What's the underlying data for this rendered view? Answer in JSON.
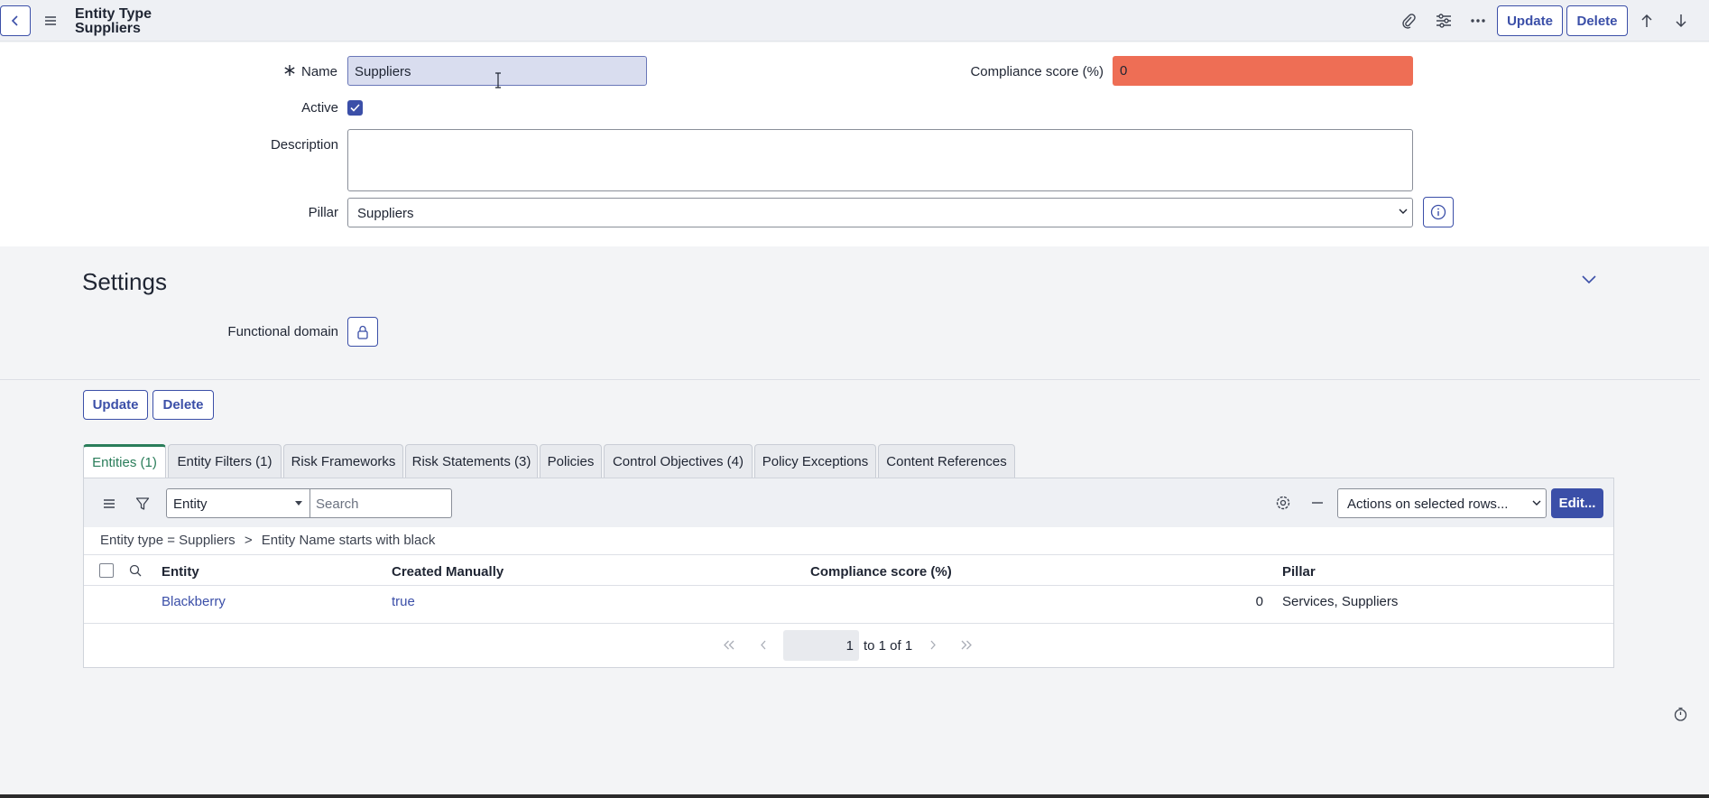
{
  "header": {
    "title_line1": "Entity Type",
    "title_line2": "Suppliers",
    "update_label": "Update",
    "delete_label": "Delete"
  },
  "form": {
    "name_label": "Name",
    "name_value": "Suppliers",
    "active_label": "Active",
    "active_checked": true,
    "description_label": "Description",
    "description_value": "",
    "pillar_label": "Pillar",
    "pillar_value": "Suppliers",
    "compliance_label": "Compliance score (%)",
    "compliance_value": "0"
  },
  "settings": {
    "title": "Settings",
    "functional_domain_label": "Functional domain"
  },
  "actions": {
    "update_label": "Update",
    "delete_label": "Delete"
  },
  "tabs": [
    {
      "label": "Entities (1)",
      "active": true
    },
    {
      "label": "Entity Filters (1)"
    },
    {
      "label": "Risk Frameworks"
    },
    {
      "label": "Risk Statements (3)"
    },
    {
      "label": "Policies"
    },
    {
      "label": "Control Objectives (4)"
    },
    {
      "label": "Policy Exceptions"
    },
    {
      "label": "Content References"
    }
  ],
  "list": {
    "filter_field": "Entity",
    "search_placeholder": "Search",
    "actions_select": "Actions on selected rows...",
    "edit_label": "Edit...",
    "breadcrumb_part1": "Entity type = Suppliers",
    "breadcrumb_sep": ">",
    "breadcrumb_part2": "Entity Name starts with black",
    "columns": [
      "Entity",
      "Created Manually",
      "Compliance score (%)",
      "Pillar"
    ],
    "rows": [
      {
        "entity": "Blackberry",
        "created_manually": "true",
        "compliance": "0",
        "pillar": "Services, Suppliers"
      }
    ],
    "pager_page": "1",
    "pager_text": "to 1 of 1"
  },
  "colors": {
    "accent": "#3b4fa8",
    "active_tab": "#2a7d5a",
    "compliance_bg": "#ee6e55"
  }
}
